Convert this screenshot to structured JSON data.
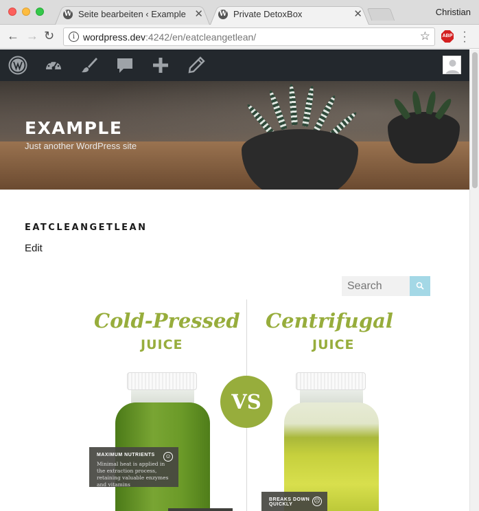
{
  "browser": {
    "tabs": [
      {
        "title": "Seite bearbeiten ‹ Example —",
        "active": false
      },
      {
        "title": "Private DetoxBox",
        "active": true
      }
    ],
    "profile_name": "Christian",
    "url_host": "wordpress.dev",
    "url_port_path": ":4242/en/eatcleangetlean/",
    "extension_label": "ABP"
  },
  "adminbar": {
    "icons": [
      "wordpress-icon",
      "dashboard-icon",
      "customize-brush-icon",
      "comments-icon",
      "new-plus-icon",
      "edit-pencil-icon"
    ]
  },
  "site": {
    "title": "EXAMPLE",
    "description": "Just another WordPress site"
  },
  "page": {
    "title": "EATCLEANGETLEAN",
    "edit_label": "Edit"
  },
  "search": {
    "placeholder": "Search"
  },
  "infographic": {
    "left_heading": "Cold-Pressed",
    "left_sub": "JUICE",
    "right_heading": "Centrifugal",
    "right_sub": "JUICE",
    "vs_label": "VS",
    "left_callout_title": "MAXIMUM NUTRIENTS",
    "left_callout_body": "Minimal heat is applied in the extraction process, retaining valuable enzymes and vitamins",
    "right_callout_title": "BREAKS DOWN QUICKLY",
    "colors": {
      "accent": "#97ad3c",
      "left_juice": "#5e8a22",
      "right_juice": "#b5c43a"
    }
  }
}
